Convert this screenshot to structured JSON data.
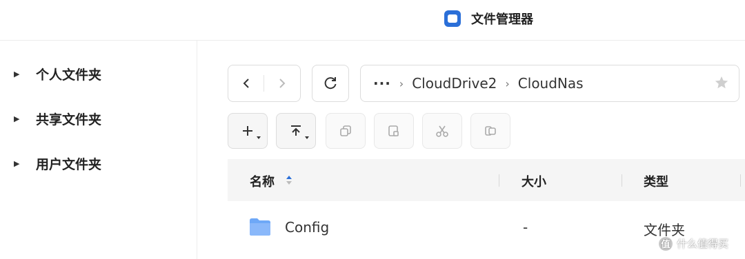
{
  "window": {
    "title": "文件管理器"
  },
  "sidebar": {
    "items": [
      {
        "label": "个人文件夹"
      },
      {
        "label": "共享文件夹"
      },
      {
        "label": "用户文件夹"
      }
    ]
  },
  "pathbar": {
    "more": "···",
    "crumbs": [
      "CloudDrive2",
      "CloudNas"
    ]
  },
  "table": {
    "headers": {
      "name": "名称",
      "size": "大小",
      "type": "类型"
    },
    "rows": [
      {
        "name": "Config",
        "size": "-",
        "type": "文件夹"
      }
    ]
  },
  "watermark": {
    "logo": "值",
    "text": "什么值得买"
  },
  "colors": {
    "accent": "#2b6fd8",
    "folder": "#6ea8f7",
    "border": "#dcdcdc"
  }
}
